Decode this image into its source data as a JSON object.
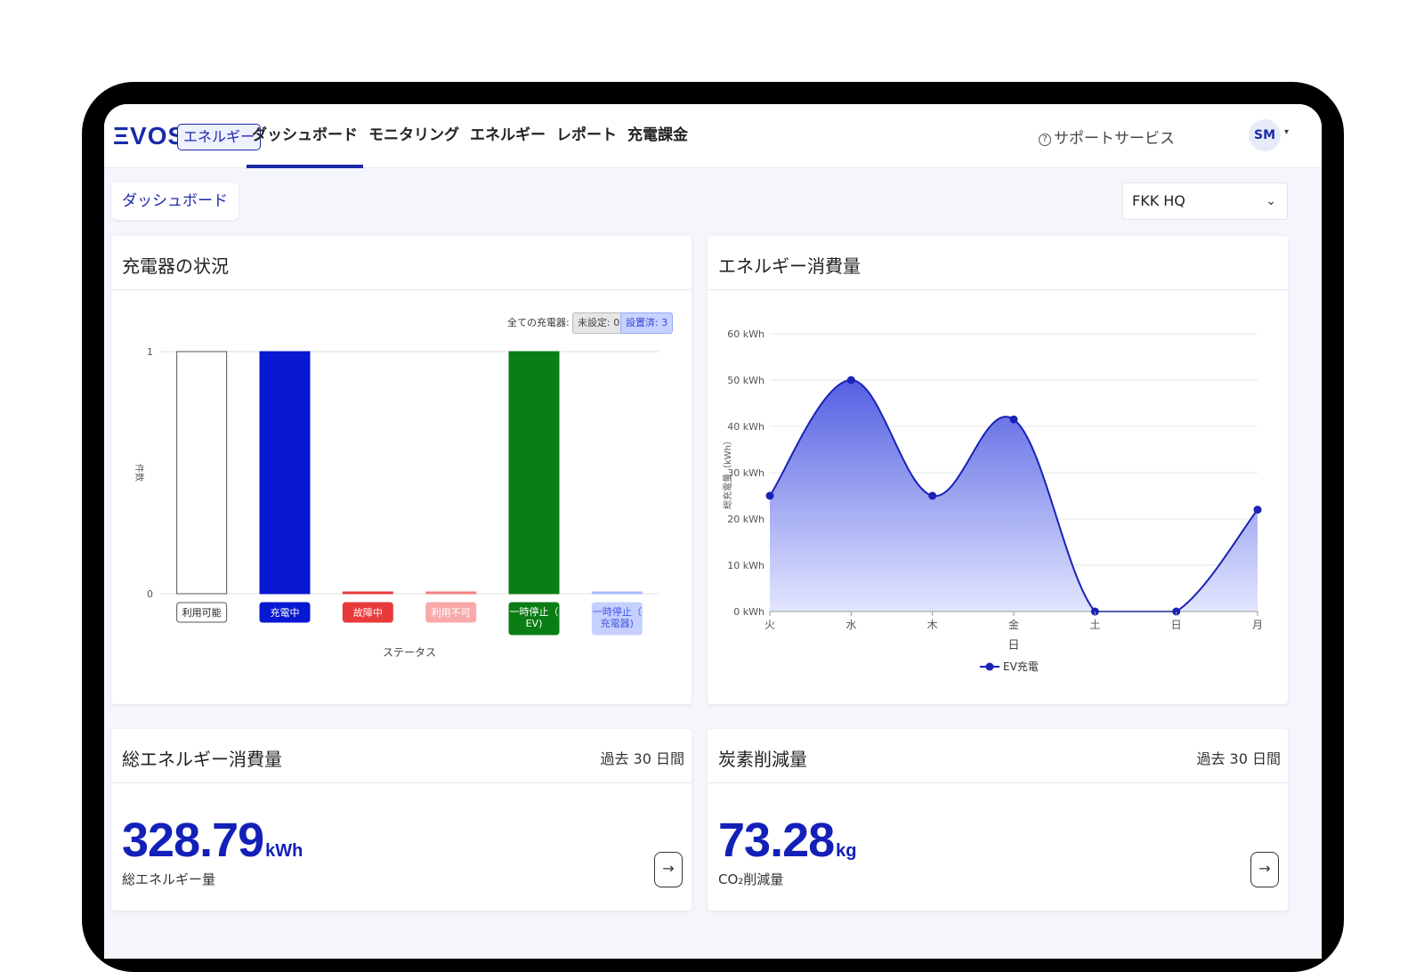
{
  "header": {
    "logo": "ΞVOS",
    "logo_tag": "エネルギー",
    "nav": [
      {
        "label": "ダッシュボード",
        "active": true
      },
      {
        "label": "モニタリング",
        "active": false
      },
      {
        "label": "エネルギー",
        "active": false
      },
      {
        "label": "レポート",
        "active": false
      },
      {
        "label": "充電課金",
        "active": false
      }
    ],
    "support_label": "サポートサービス",
    "avatar_initials": "SM"
  },
  "toolbar": {
    "breadcrumb": "ダッシュボード",
    "site_selected": "FKK HQ"
  },
  "charger_status": {
    "title": "充電器の状況",
    "summary_total": "全ての充電器: 3",
    "summary_unset": "未設定: 0",
    "summary_installed": "設置済: 3",
    "chart_data": {
      "type": "bar",
      "categories": [
        "利用可能",
        "充電中",
        "故障中",
        "利用不可",
        "一時停止（EV)",
        "一時停止（充電器)"
      ],
      "values": [
        1,
        1,
        0,
        0,
        1,
        0
      ],
      "ylabel": "件数",
      "xlabel": "ステータス",
      "ylim": [
        0,
        1
      ],
      "yticks": [
        "0",
        "1"
      ],
      "colors": {
        "bar_fill": [
          "#ffffff",
          "#0818d0",
          "#e83a3a",
          "#f08080",
          "#0a7d14",
          "#a8b8ff"
        ],
        "bar_stroke": [
          "#555555",
          "#0818d0",
          "#e83a3a",
          "#f08080",
          "#0a7d14",
          "#a8b8ff"
        ],
        "label_bg": [
          "#ffffff",
          "#0818d0",
          "#e83a3a",
          "#f9a9a9",
          "#0a7d14",
          "#c5d0ff"
        ],
        "label_fg": [
          "#222222",
          "#ffffff",
          "#ffffff",
          "#ffffff",
          "#ffffff",
          "#4457e0"
        ]
      }
    }
  },
  "energy_usage": {
    "title": "エネルギー消費量",
    "chart_data": {
      "type": "area",
      "x": [
        "火",
        "水",
        "木",
        "金",
        "土",
        "日",
        "月"
      ],
      "series": [
        {
          "name": "EV充電",
          "values": [
            25,
            50,
            25,
            41.5,
            0,
            0,
            22
          ]
        }
      ],
      "xlabel": "日",
      "ylabel": "総充電量（kWh）",
      "ylim": [
        0,
        60
      ],
      "yticks": [
        "0 kWh",
        "10 kWh",
        "20 kWh",
        "30 kWh",
        "40 kWh",
        "50 kWh",
        "60 kWh"
      ],
      "grid": true,
      "legend": "bottom",
      "colors": {
        "line": "#1a22b8",
        "fill_top": "#4a57e0",
        "fill_bottom": "#dfe3ff"
      }
    }
  },
  "total_energy": {
    "title": "総エネルギー消費量",
    "period": "過去 30 日間",
    "value": "328.79",
    "unit": "kWh",
    "caption": "総エネルギー量",
    "arrow": "→"
  },
  "carbon": {
    "title": "炭素削減量",
    "period": "過去 30 日間",
    "value": "73.28",
    "unit": "kg",
    "caption": "CO₂削減量",
    "arrow": "→"
  }
}
